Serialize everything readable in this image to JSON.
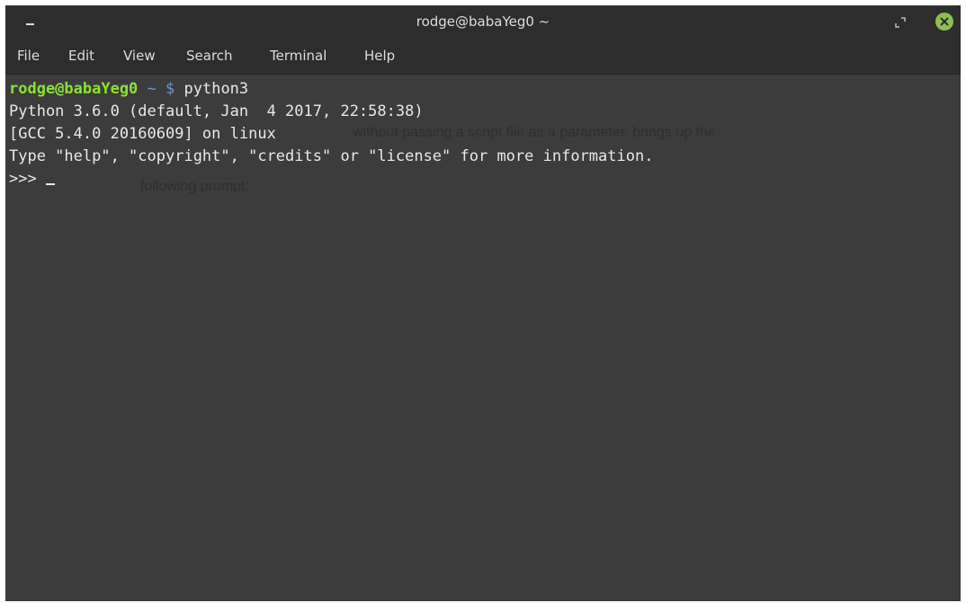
{
  "window": {
    "title": "rodge@babaYeg0 ~"
  },
  "menu": {
    "items": [
      "File",
      "Edit",
      "View",
      "Search",
      "Terminal",
      "Help"
    ]
  },
  "terminal": {
    "prompt_user": "rodge@babaYeg0",
    "prompt_path": " ~ ",
    "prompt_symbol": "$",
    "command": " python3",
    "output": [
      "Python 3.6.0 (default, Jan  4 2017, 22:58:38)",
      "[GCC 5.4.0 20160609] on linux",
      "Type \"help\", \"copyright\", \"credits\" or \"license\" for more information."
    ],
    "repl_prompt": ">>>"
  },
  "background_text": {
    "line1": "without passing a script file as a parameter, brings up the",
    "line2": "following prompt:"
  },
  "colors": {
    "titlebar": "#2d2d2d",
    "terminal_bg": "#3c3c3c",
    "prompt_user": "#8ae234",
    "prompt_path": "#6f94c9",
    "close_button": "#8cc051"
  }
}
